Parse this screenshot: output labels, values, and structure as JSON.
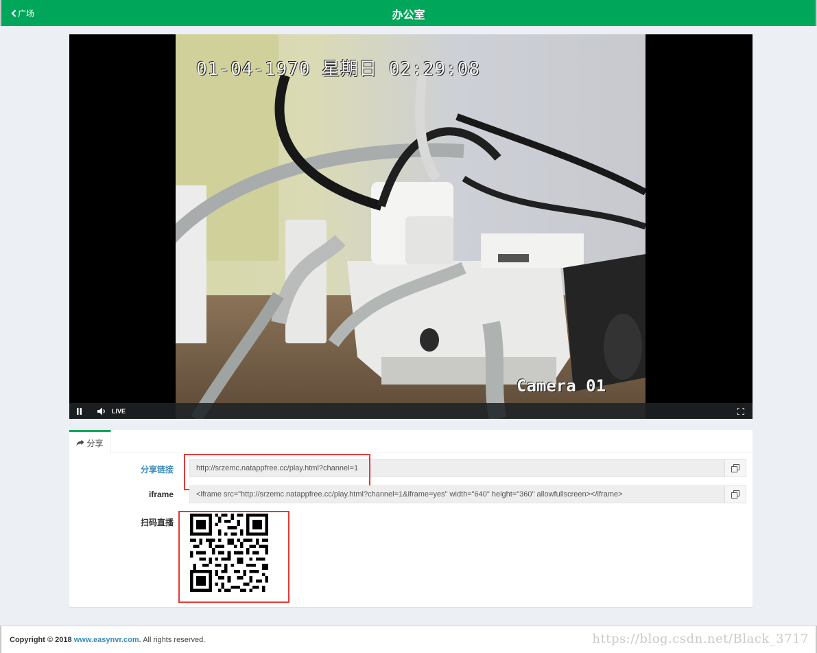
{
  "header": {
    "back_label": "广场",
    "title": "办公室"
  },
  "player": {
    "osd_timestamp": "01-04-1970 星期日 02:29:08",
    "osd_camera": "Camera 01",
    "live_label": "LIVE",
    "icons": [
      "pause-icon",
      "volume-icon",
      "fullscreen-icon"
    ]
  },
  "share": {
    "tab_label": "分享",
    "link_label": "分享链接",
    "link_value": "http://srzemc.natappfree.cc/play.html?channel=1",
    "iframe_label": "iframe",
    "iframe_value": "<iframe src=\"http://srzemc.natappfree.cc/play.html?channel=1&iframe=yes\" width=\"640\" height=\"360\" allowfullscreen></iframe>",
    "qr_label": "扫码直播"
  },
  "footer": {
    "copyright_prefix": "Copyright © 2018",
    "site": "www.easynvr.com.",
    "rights": "All rights reserved.",
    "watermark": "https://blog.csdn.net/Black_3717"
  },
  "colors": {
    "header_green": "#00a65a",
    "link_blue": "#3c8dbc",
    "annotation_red": "#e53935",
    "page_bg": "#ecf0f5"
  }
}
